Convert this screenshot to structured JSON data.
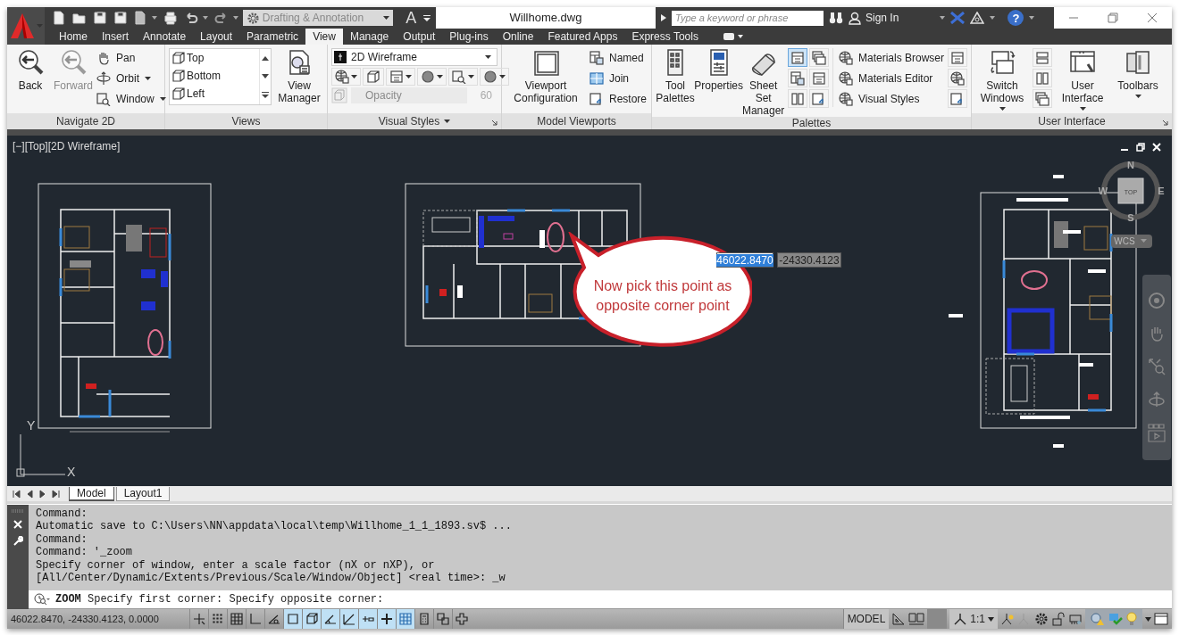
{
  "title_bar": {
    "workspace": "Drafting & Annotation",
    "text_button": "A",
    "document_title": "Willhome.dwg",
    "search": {
      "placeholder": "Type a keyword or phrase"
    },
    "sign_in": "Sign In",
    "help": "?"
  },
  "ribbon_tabs": [
    {
      "label": "Home",
      "selected": false
    },
    {
      "label": "Insert",
      "selected": false
    },
    {
      "label": "Annotate",
      "selected": false
    },
    {
      "label": "Layout",
      "selected": false
    },
    {
      "label": "Parametric",
      "selected": false
    },
    {
      "label": "View",
      "selected": true
    },
    {
      "label": "Manage",
      "selected": false
    },
    {
      "label": "Output",
      "selected": false
    },
    {
      "label": "Plug-ins",
      "selected": false
    },
    {
      "label": "Online",
      "selected": false
    },
    {
      "label": "Featured Apps",
      "selected": false
    },
    {
      "label": "Express Tools",
      "selected": false
    }
  ],
  "ribbon": {
    "navigate_2d": {
      "title": "Navigate 2D",
      "large": [
        {
          "label": "Back",
          "disabled": false
        },
        {
          "label": "Forward",
          "disabled": true
        }
      ],
      "small": [
        {
          "label": "Pan",
          "dropdown": false
        },
        {
          "label": "Orbit",
          "dropdown": true
        },
        {
          "label": "Window",
          "dropdown": true
        }
      ]
    },
    "views": {
      "title": "Views",
      "list": [
        {
          "label": "Top"
        },
        {
          "label": "Bottom"
        },
        {
          "label": "Left"
        }
      ],
      "manager": "View Manager"
    },
    "visual_styles": {
      "title": "Visual Styles",
      "style": "2D Wireframe",
      "opacity": {
        "label": "Opacity",
        "value": "60",
        "disabled": true
      }
    },
    "model_viewports": {
      "title": "Model Viewports",
      "configuration": "Viewport Configuration",
      "small": [
        "Named",
        "Join",
        "Restore"
      ]
    },
    "palettes": {
      "title": "Palettes",
      "large": [
        "Tool Palettes",
        "Properties",
        "Sheet Set Manager"
      ],
      "toggles": [
        {
          "selected": true
        },
        {
          "selected": false
        },
        {
          "selected": false
        },
        {
          "selected": false
        },
        {
          "selected": false
        },
        {
          "selected": false
        }
      ],
      "small": [
        "Materials Browser",
        "Materials Editor",
        "Visual Styles"
      ]
    },
    "user_interface": {
      "title": "User Interface",
      "large": [
        {
          "label": "Switch Windows",
          "dropdown": true
        },
        {
          "label": "User Interface",
          "dropdown": true
        },
        {
          "label": "Toolbars",
          "dropdown": true
        }
      ]
    }
  },
  "viewport": {
    "label": "[−][Top][2D Wireframe]",
    "callout": "Now pick this point as opposite corner point",
    "coordinate_inputs": [
      {
        "value": "46022.8470",
        "selected": true
      },
      {
        "value": "-24330.4123",
        "selected": false
      }
    ],
    "viewcube": {
      "north": "N",
      "south": "S",
      "east": "E",
      "west": "W",
      "face": "TOP",
      "ucs": "WCS"
    },
    "ucs_icon": {
      "x": "X",
      "y": "Y"
    }
  },
  "layout_tabs": [
    {
      "label": "Model",
      "selected": true
    },
    {
      "label": "Layout1",
      "selected": false
    }
  ],
  "command_history": [
    "Command:",
    "Automatic save to C:\\Users\\NN\\appdata\\local\\temp\\Willhome_1_1_1893.sv$ ...",
    "Command:",
    "Command: '_zoom",
    "Specify corner of window, enter a scale factor (nX or nXP), or",
    "[All/Center/Dynamic/Extents/Previous/Scale/Window/Object] <real time>: _w"
  ],
  "command_line": "**ZOOM** Specify first corner: Specify opposite corner:",
  "status_bar": {
    "coordinates": "46022.8470, -24330.4123, 0.0000",
    "toggles": [
      {
        "kind": "infer",
        "on": false
      },
      {
        "kind": "snap",
        "on": false
      },
      {
        "kind": "grid",
        "on": false
      },
      {
        "kind": "ortho",
        "on": false
      },
      {
        "kind": "polar",
        "on": false
      },
      {
        "kind": "isodraft",
        "on": true
      },
      {
        "kind": "osnap",
        "on": true
      },
      {
        "kind": "angle",
        "on": true
      },
      {
        "kind": "tracking",
        "on": true
      },
      {
        "kind": "lineweight",
        "on": true
      },
      {
        "kind": "plus",
        "on": true
      },
      {
        "kind": "transparency",
        "on": true
      },
      {
        "kind": "calculator",
        "on": false
      },
      {
        "kind": "cycling",
        "on": false
      },
      {
        "kind": "cross",
        "on": false
      }
    ],
    "model": "MODEL",
    "scale": "1:1"
  }
}
